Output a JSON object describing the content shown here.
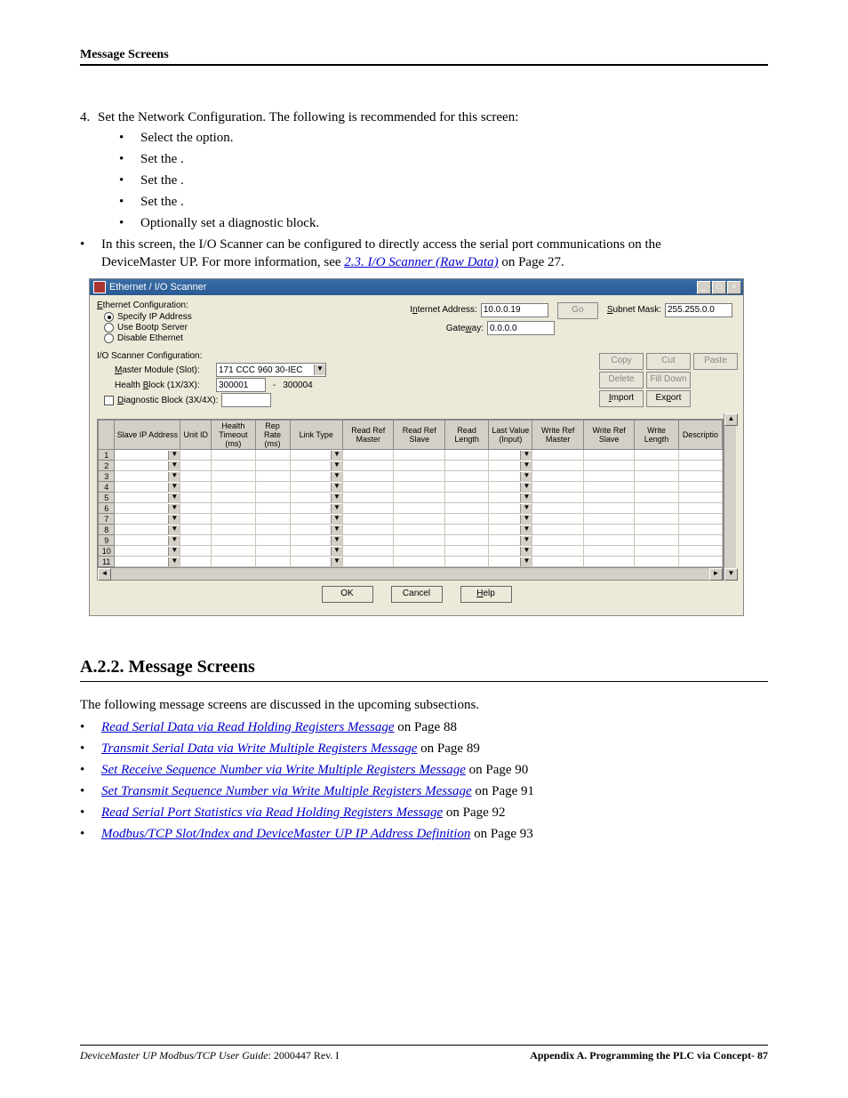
{
  "header": {
    "title": "Message Screens"
  },
  "step4": {
    "num": "4.",
    "text": "Set the Network Configuration. The following is recommended for this screen:",
    "items": [
      "Select the                                 option.",
      "Set the                               .",
      "Set the                       .",
      "Set the               .",
      "Optionally set a diagnostic block."
    ]
  },
  "outer_bullet": {
    "line1": "In this screen, the I/O Scanner can be configured to directly access the serial port communications on the",
    "line2a": "DeviceMaster UP. For more information, see ",
    "link": "2.3. I/O Scanner (Raw Data)",
    "line2b": " on Page 27."
  },
  "dialog": {
    "title": "Ethernet / I/O Scanner",
    "eth_cfg_label": "Ethernet Configuration:",
    "radios": [
      "Specify IP Address",
      "Use Bootp Server",
      "Disable Ethernet"
    ],
    "internet_addr_lbl": "Internet Address:",
    "internet_addr_val": "10.0.0.19",
    "go_btn": "Go",
    "subnet_lbl": "Subnet Mask:",
    "subnet_val": "255.255.0.0",
    "gateway_lbl": "Gateway:",
    "gateway_val": "0.0.0.0",
    "io_cfg_label": "I/O Scanner Configuration:",
    "master_lbl": "Master Module (Slot):",
    "master_val": "171 CCC 960 30-IEC",
    "health_lbl": "Health Block (1X/3X):",
    "health_val1": "300001",
    "health_sep": "-",
    "health_val2": "300004",
    "diag_lbl": "Diagnostic Block (3X/4X):",
    "btns": {
      "copy": "Copy",
      "cut": "Cut",
      "paste": "Paste",
      "delete": "Delete",
      "fill": "Fill Down",
      "import": "Import",
      "export": "Export"
    },
    "columns": [
      "",
      "Slave IP Address",
      "Unit ID",
      "Health Timeout (ms)",
      "Rep Rate (ms)",
      "Link Type",
      "Read Ref Master",
      "Read Ref Slave",
      "Read Length",
      "Last Value (Input)",
      "Write Ref Master",
      "Write Ref Slave",
      "Write Length",
      "Descriptio"
    ],
    "rows": [
      "1",
      "2",
      "3",
      "4",
      "5",
      "6",
      "7",
      "8",
      "9",
      "10",
      "11"
    ],
    "footer": {
      "ok": "OK",
      "cancel": "Cancel",
      "help": "Help"
    }
  },
  "section": {
    "heading": "A.2.2. Message Screens",
    "intro": "The following message screens are discussed in the upcoming subsections.",
    "items": [
      {
        "link": "Read Serial Data via Read Holding Registers Message",
        "tail": " on Page 88"
      },
      {
        "link": "Transmit Serial Data via Write Multiple Registers Message",
        "tail": " on Page 89"
      },
      {
        "link": "Set Receive Sequence Number via Write Multiple Registers Message",
        "tail": " on Page 90"
      },
      {
        "link": "Set Transmit Sequence Number via Write Multiple Registers Message",
        "tail": " on Page 91"
      },
      {
        "link": "Read Serial Port Statistics via Read Holding Registers Message",
        "tail": " on Page 92"
      },
      {
        "link": "Modbus/TCP Slot/Index and DeviceMaster UP IP Address Definition",
        "tail": " on Page 93"
      }
    ]
  },
  "footer": {
    "left_italic": "DeviceMaster UP Modbus/TCP User Guide",
    "left_plain": ": 2000447 Rev. I",
    "right": "Appendix A. Programming the PLC via Concept- 87"
  }
}
